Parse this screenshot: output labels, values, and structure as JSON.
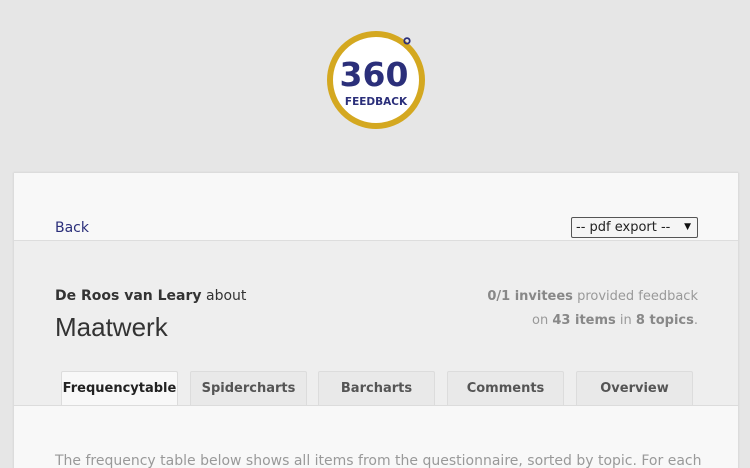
{
  "logo": {
    "number": "360",
    "degree": "°",
    "word": "FEEDBACK",
    "ring_color": "#d4a820",
    "text_color": "#2b2f7a"
  },
  "nav": {
    "back_label": "Back",
    "export_select": {
      "selected": "-- pdf export --",
      "arrow": "▼"
    }
  },
  "report": {
    "subject_name": "De Roos van Leary",
    "about_word": "about",
    "title": "Maatwerk",
    "stats": {
      "invitees": "0/1 invitees",
      "provided_text": "provided feedback",
      "on_word": "on",
      "items": "43 items",
      "in_word": "in",
      "topics": "8 topics",
      "period": "."
    }
  },
  "tabs": [
    {
      "label": "Frequencytable",
      "active": true
    },
    {
      "label": "Spidercharts",
      "active": false
    },
    {
      "label": "Barcharts",
      "active": false
    },
    {
      "label": "Comments",
      "active": false
    },
    {
      "label": "Overview",
      "active": false
    }
  ],
  "content": {
    "intro_text": "The frequency table below shows all items from the questionnaire, sorted by topic. For each"
  },
  "colors": {
    "background": "#e6e6e6",
    "link": "#2b2f7a",
    "accent": "#d4a820"
  }
}
